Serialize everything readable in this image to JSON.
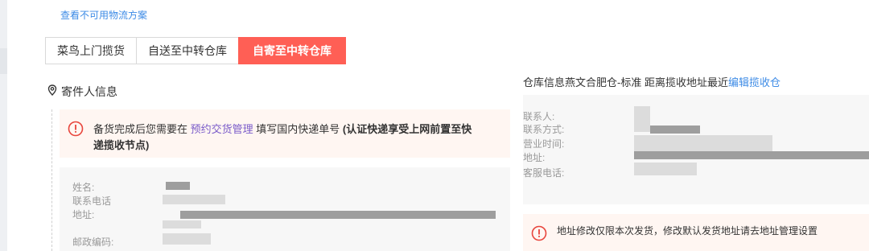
{
  "top_link": "查看不可用物流方案",
  "tabs": [
    "菜鸟上门揽货",
    "自送至中转仓库",
    "自寄至中转仓库"
  ],
  "active_tab": 2,
  "sender": {
    "title": "寄件人信息",
    "notice": {
      "before": "备货完成后您需要在",
      "link": "预约交货管理",
      "after": "填写国内快递单号",
      "bold": "(认证快递享受上网前置至快",
      "bold2": "递揽收节点)"
    },
    "fields": {
      "name": "姓名:",
      "phone": "联系电话",
      "address": "地址:",
      "postcode": "邮政编码:"
    }
  },
  "warehouse": {
    "heading": "仓库信息燕文合肥仓-标准 距离揽收地址最近",
    "edit_link": "编辑揽收仓",
    "fields": {
      "contact": "联系人:",
      "method": "联系方式:",
      "hours": "营业时间:",
      "address": "地址:",
      "service": "客服电话:"
    }
  },
  "warning": "地址修改仅限本次发货，修改默认发货地址请去地址管理设置",
  "colors": {
    "accent": "#ff5f55",
    "link": "#3d8be6",
    "notice_bg": "#fff6f2"
  },
  "icons": {
    "sender": "location-icon",
    "notice": "warning-circle-icon"
  }
}
